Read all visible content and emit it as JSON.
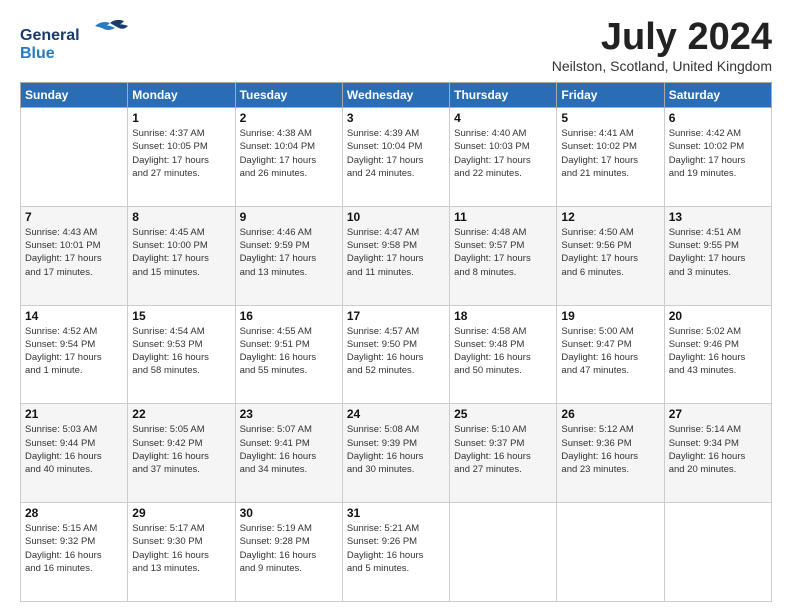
{
  "header": {
    "logo_line1": "General",
    "logo_line2": "Blue",
    "month_title": "July 2024",
    "location": "Neilston, Scotland, United Kingdom"
  },
  "days_of_week": [
    "Sunday",
    "Monday",
    "Tuesday",
    "Wednesday",
    "Thursday",
    "Friday",
    "Saturday"
  ],
  "weeks": [
    [
      {
        "day": "",
        "info": ""
      },
      {
        "day": "1",
        "info": "Sunrise: 4:37 AM\nSunset: 10:05 PM\nDaylight: 17 hours\nand 27 minutes."
      },
      {
        "day": "2",
        "info": "Sunrise: 4:38 AM\nSunset: 10:04 PM\nDaylight: 17 hours\nand 26 minutes."
      },
      {
        "day": "3",
        "info": "Sunrise: 4:39 AM\nSunset: 10:04 PM\nDaylight: 17 hours\nand 24 minutes."
      },
      {
        "day": "4",
        "info": "Sunrise: 4:40 AM\nSunset: 10:03 PM\nDaylight: 17 hours\nand 22 minutes."
      },
      {
        "day": "5",
        "info": "Sunrise: 4:41 AM\nSunset: 10:02 PM\nDaylight: 17 hours\nand 21 minutes."
      },
      {
        "day": "6",
        "info": "Sunrise: 4:42 AM\nSunset: 10:02 PM\nDaylight: 17 hours\nand 19 minutes."
      }
    ],
    [
      {
        "day": "7",
        "info": "Sunrise: 4:43 AM\nSunset: 10:01 PM\nDaylight: 17 hours\nand 17 minutes."
      },
      {
        "day": "8",
        "info": "Sunrise: 4:45 AM\nSunset: 10:00 PM\nDaylight: 17 hours\nand 15 minutes."
      },
      {
        "day": "9",
        "info": "Sunrise: 4:46 AM\nSunset: 9:59 PM\nDaylight: 17 hours\nand 13 minutes."
      },
      {
        "day": "10",
        "info": "Sunrise: 4:47 AM\nSunset: 9:58 PM\nDaylight: 17 hours\nand 11 minutes."
      },
      {
        "day": "11",
        "info": "Sunrise: 4:48 AM\nSunset: 9:57 PM\nDaylight: 17 hours\nand 8 minutes."
      },
      {
        "day": "12",
        "info": "Sunrise: 4:50 AM\nSunset: 9:56 PM\nDaylight: 17 hours\nand 6 minutes."
      },
      {
        "day": "13",
        "info": "Sunrise: 4:51 AM\nSunset: 9:55 PM\nDaylight: 17 hours\nand 3 minutes."
      }
    ],
    [
      {
        "day": "14",
        "info": "Sunrise: 4:52 AM\nSunset: 9:54 PM\nDaylight: 17 hours\nand 1 minute."
      },
      {
        "day": "15",
        "info": "Sunrise: 4:54 AM\nSunset: 9:53 PM\nDaylight: 16 hours\nand 58 minutes."
      },
      {
        "day": "16",
        "info": "Sunrise: 4:55 AM\nSunset: 9:51 PM\nDaylight: 16 hours\nand 55 minutes."
      },
      {
        "day": "17",
        "info": "Sunrise: 4:57 AM\nSunset: 9:50 PM\nDaylight: 16 hours\nand 52 minutes."
      },
      {
        "day": "18",
        "info": "Sunrise: 4:58 AM\nSunset: 9:48 PM\nDaylight: 16 hours\nand 50 minutes."
      },
      {
        "day": "19",
        "info": "Sunrise: 5:00 AM\nSunset: 9:47 PM\nDaylight: 16 hours\nand 47 minutes."
      },
      {
        "day": "20",
        "info": "Sunrise: 5:02 AM\nSunset: 9:46 PM\nDaylight: 16 hours\nand 43 minutes."
      }
    ],
    [
      {
        "day": "21",
        "info": "Sunrise: 5:03 AM\nSunset: 9:44 PM\nDaylight: 16 hours\nand 40 minutes."
      },
      {
        "day": "22",
        "info": "Sunrise: 5:05 AM\nSunset: 9:42 PM\nDaylight: 16 hours\nand 37 minutes."
      },
      {
        "day": "23",
        "info": "Sunrise: 5:07 AM\nSunset: 9:41 PM\nDaylight: 16 hours\nand 34 minutes."
      },
      {
        "day": "24",
        "info": "Sunrise: 5:08 AM\nSunset: 9:39 PM\nDaylight: 16 hours\nand 30 minutes."
      },
      {
        "day": "25",
        "info": "Sunrise: 5:10 AM\nSunset: 9:37 PM\nDaylight: 16 hours\nand 27 minutes."
      },
      {
        "day": "26",
        "info": "Sunrise: 5:12 AM\nSunset: 9:36 PM\nDaylight: 16 hours\nand 23 minutes."
      },
      {
        "day": "27",
        "info": "Sunrise: 5:14 AM\nSunset: 9:34 PM\nDaylight: 16 hours\nand 20 minutes."
      }
    ],
    [
      {
        "day": "28",
        "info": "Sunrise: 5:15 AM\nSunset: 9:32 PM\nDaylight: 16 hours\nand 16 minutes."
      },
      {
        "day": "29",
        "info": "Sunrise: 5:17 AM\nSunset: 9:30 PM\nDaylight: 16 hours\nand 13 minutes."
      },
      {
        "day": "30",
        "info": "Sunrise: 5:19 AM\nSunset: 9:28 PM\nDaylight: 16 hours\nand 9 minutes."
      },
      {
        "day": "31",
        "info": "Sunrise: 5:21 AM\nSunset: 9:26 PM\nDaylight: 16 hours\nand 5 minutes."
      },
      {
        "day": "",
        "info": ""
      },
      {
        "day": "",
        "info": ""
      },
      {
        "day": "",
        "info": ""
      }
    ]
  ]
}
